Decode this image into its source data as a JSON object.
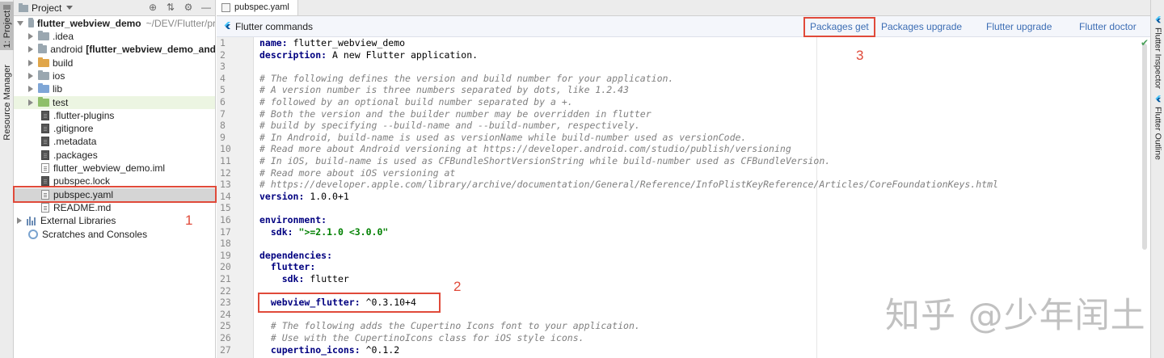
{
  "left_stripe": {
    "project_tab": "1: Project",
    "resource_tab": "Resource Manager"
  },
  "project_panel": {
    "title": "Project",
    "items": [
      {
        "label": "flutter_webview_demo",
        "extra": "~/DEV/Flutter/pr"
      },
      {
        "label": ".idea"
      },
      {
        "label": "android",
        "extra": "[flutter_webview_demo_and"
      },
      {
        "label": "build"
      },
      {
        "label": "ios"
      },
      {
        "label": "lib"
      },
      {
        "label": "test"
      },
      {
        "label": ".flutter-plugins"
      },
      {
        "label": ".gitignore"
      },
      {
        "label": ".metadata"
      },
      {
        "label": ".packages"
      },
      {
        "label": "flutter_webview_demo.iml"
      },
      {
        "label": "pubspec.lock"
      },
      {
        "label": "pubspec.yaml"
      },
      {
        "label": "README.md"
      },
      {
        "label": "External Libraries"
      },
      {
        "label": "Scratches and Consoles"
      }
    ]
  },
  "editor": {
    "tab_label": "pubspec.yaml",
    "commands_title": "Flutter commands",
    "commands": [
      "Packages get",
      "Packages upgrade",
      "Flutter upgrade",
      "Flutter doctor"
    ],
    "line_numbers": [
      "1",
      "2",
      "3",
      "4",
      "5",
      "6",
      "7",
      "8",
      "9",
      "10",
      "11",
      "12",
      "13",
      "14",
      "15",
      "16",
      "17",
      "18",
      "19",
      "20",
      "21",
      "22",
      "23",
      "24",
      "25",
      "26",
      "27"
    ],
    "lines": [
      {
        "key": "name",
        "value": " flutter_webview_demo"
      },
      {
        "key": "description",
        "value": " A new Flutter application."
      },
      {},
      {
        "comment": "# The following defines the version and build number for your application."
      },
      {
        "comment": "# A version number is three numbers separated by dots, like 1.2.43"
      },
      {
        "comment": "# followed by an optional build number separated by a +."
      },
      {
        "comment": "# Both the version and the builder number may be overridden in flutter"
      },
      {
        "comment": "# build by specifying --build-name and --build-number, respectively."
      },
      {
        "comment": "# In Android, build-name is used as versionName while build-number used as versionCode."
      },
      {
        "comment": "# Read more about Android versioning at https://developer.android.com/studio/publish/versioning"
      },
      {
        "comment": "# In iOS, build-name is used as CFBundleShortVersionString while build-number used as CFBundleVersion."
      },
      {
        "comment": "# Read more about iOS versioning at"
      },
      {
        "comment": "# https://developer.apple.com/library/archive/documentation/General/Reference/InfoPlistKeyReference/Articles/CoreFoundationKeys.html"
      },
      {
        "key": "version",
        "value": " 1.0.0+1"
      },
      {},
      {
        "key": "environment",
        "value": ""
      },
      {
        "indent": "  ",
        "key": "sdk",
        "string": "\">=2.1.0 <3.0.0\""
      },
      {},
      {
        "key": "dependencies",
        "value": ""
      },
      {
        "indent": "  ",
        "key": "flutter",
        "value": ""
      },
      {
        "indent": "    ",
        "key": "sdk",
        "value": " flutter"
      },
      {},
      {
        "indent": "  ",
        "key": "webview_flutter",
        "value": " ^0.3.10+4"
      },
      {},
      {
        "comment": "  # The following adds the Cupertino Icons font to your application."
      },
      {
        "comment": "  # Use with the CupertinoIcons class for iOS style icons."
      },
      {
        "indent": "  ",
        "key": "cupertino_icons",
        "value": " ^0.1.2"
      }
    ]
  },
  "right_stripe": {
    "inspector_tab": "Flutter Inspector",
    "outline_tab": "Flutter Outline"
  },
  "annotations": [
    "1",
    "2",
    "3"
  ],
  "watermark": "知乎 @少年闰土",
  "colors": {
    "annotation": "#e04a3a",
    "link": "#3c6db4",
    "keyword": "#000080",
    "comment": "#808080",
    "string": "#008000"
  }
}
